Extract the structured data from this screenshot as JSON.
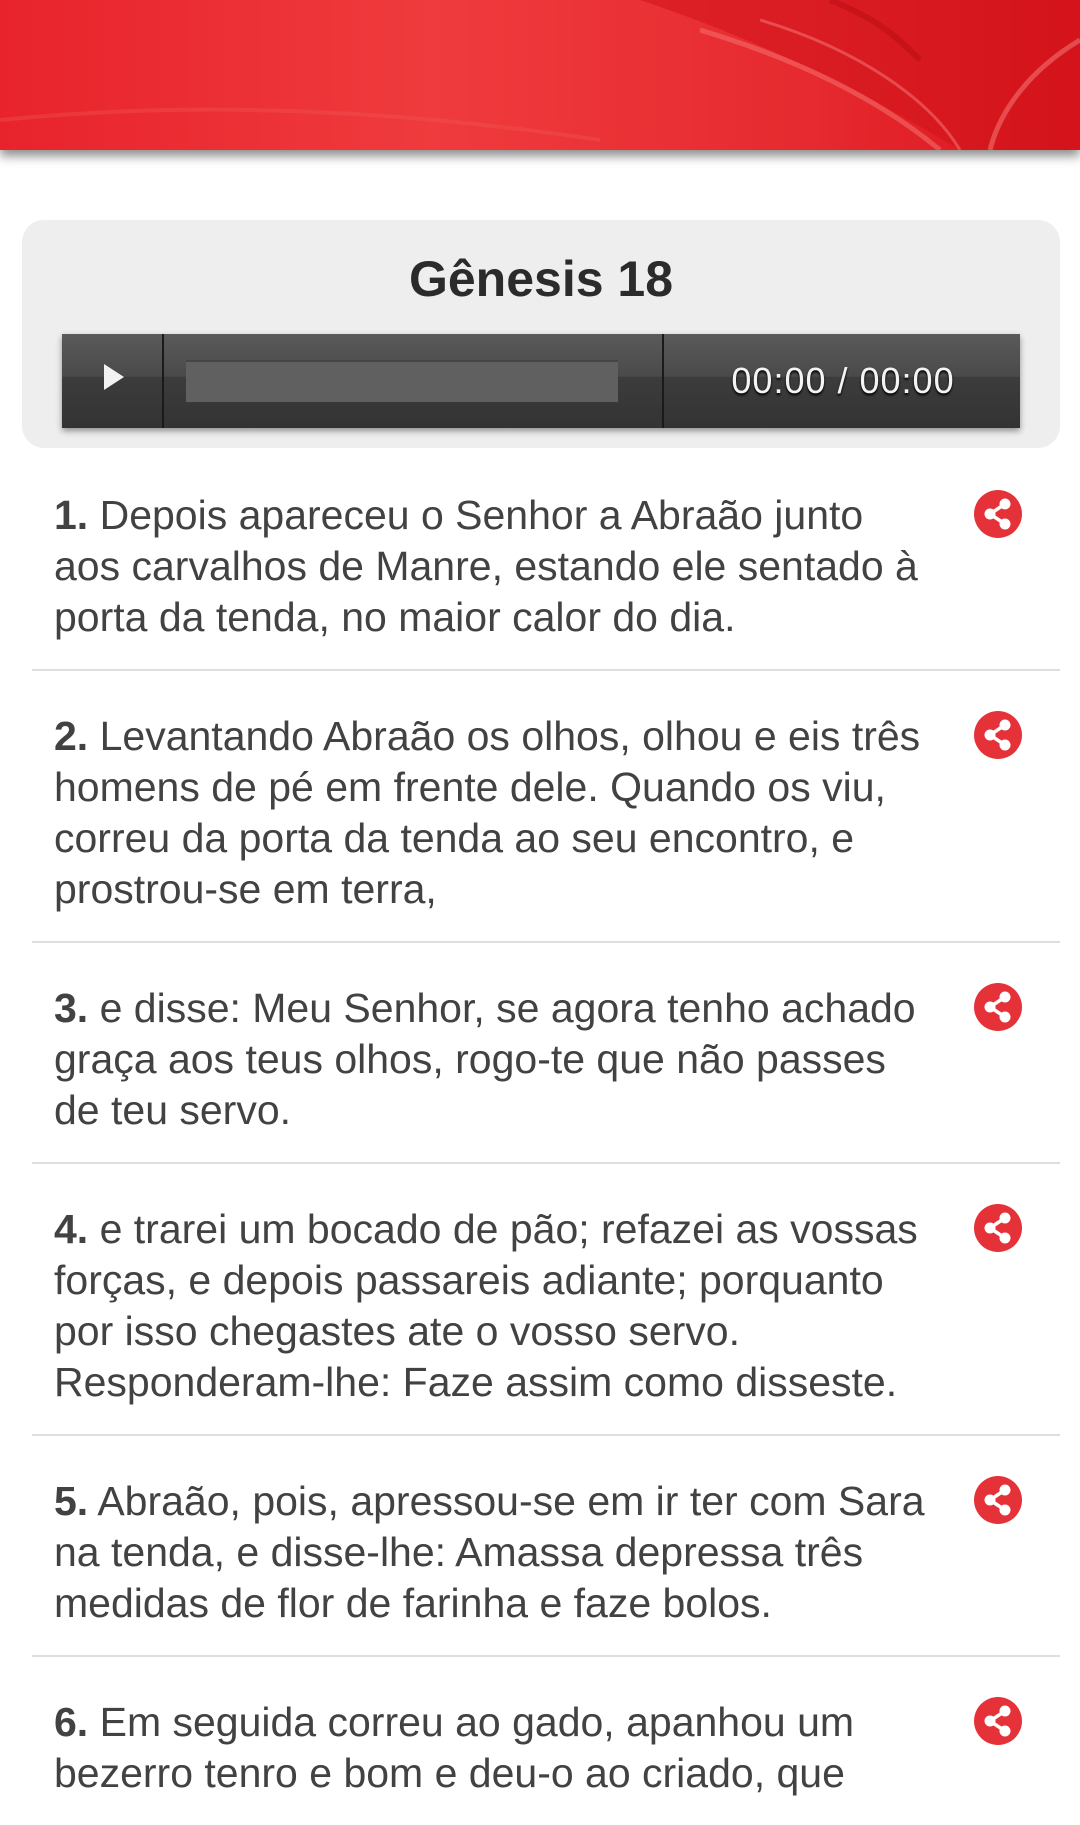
{
  "header": {
    "banner_icon": "open-book-illustration",
    "accent_color": "#e8232b"
  },
  "player": {
    "chapter_title": "Gênesis 18",
    "time_display": "00:00 / 00:00",
    "play_icon": "play-icon"
  },
  "verses": [
    {
      "number": "1.",
      "text": " Depois apareceu o Senhor a Abraão junto aos carvalhos de Manre, estando ele sentado à porta da tenda, no maior calor do dia."
    },
    {
      "number": "2.",
      "text": " Levantando Abraão os olhos, olhou e eis três homens de pé em frente dele. Quando os viu, correu da porta da tenda ao seu encontro, e prostrou-se em terra,"
    },
    {
      "number": "3.",
      "text": " e disse: Meu Senhor, se agora tenho achado graça aos teus olhos, rogo-te que não passes de teu servo."
    },
    {
      "number": "4.",
      "text": " e trarei um bocado de pão; refazei as vossas forças, e depois passareis adiante; porquanto por isso chegastes ate o vosso servo. Responderam-lhe: Faze assim como disseste."
    },
    {
      "number": "5.",
      "text": " Abraão, pois, apressou-se em ir ter com Sara na tenda, e disse-lhe: Amassa depressa três medidas de flor de farinha e faze bolos."
    },
    {
      "number": "6.",
      "text": " Em seguida correu ao gado, apanhou um bezerro tenro e bom e deu-o ao criado, que"
    }
  ],
  "share_icon": "share-icon"
}
